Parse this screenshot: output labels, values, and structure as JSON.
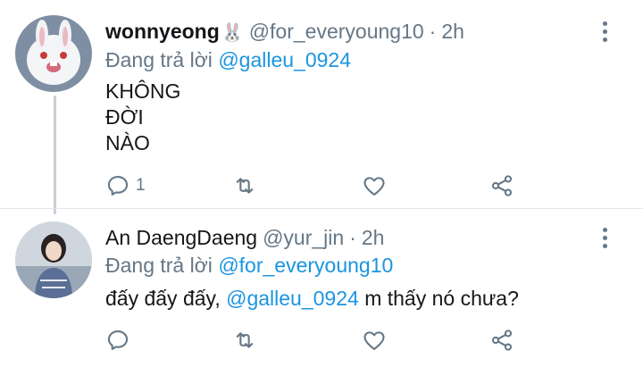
{
  "tweets": [
    {
      "name": "wonnyeong",
      "name_emoji": "🐰",
      "handle": "@for_everyoung10",
      "separator": "·",
      "time": "2h",
      "reply_prefix": "Đang trả lời",
      "reply_to": "@galleu_0924",
      "body_lines": [
        "KHÔNG",
        "ĐỜI",
        "NÀO"
      ],
      "reply_count": "1",
      "retweet_count": "",
      "like_count": ""
    },
    {
      "name": "An DaengDaeng",
      "handle": "@yur_jin",
      "separator": "·",
      "time": "2h",
      "reply_prefix": "Đang trả lời",
      "reply_to": "@for_everyoung10",
      "body_before": "đấy đấy đấy, ",
      "body_mention": "@galleu_0924",
      "body_after": " m thấy nó chưa?",
      "reply_count": "",
      "retweet_count": "",
      "like_count": ""
    }
  ],
  "icons": {
    "reply": "reply-icon",
    "retweet": "retweet-icon",
    "like": "heart-icon",
    "share": "share-icon",
    "more": "more-vertical-icon"
  },
  "colors": {
    "mention": "#1b95e0",
    "muted": "#657786",
    "text": "#14171a"
  }
}
